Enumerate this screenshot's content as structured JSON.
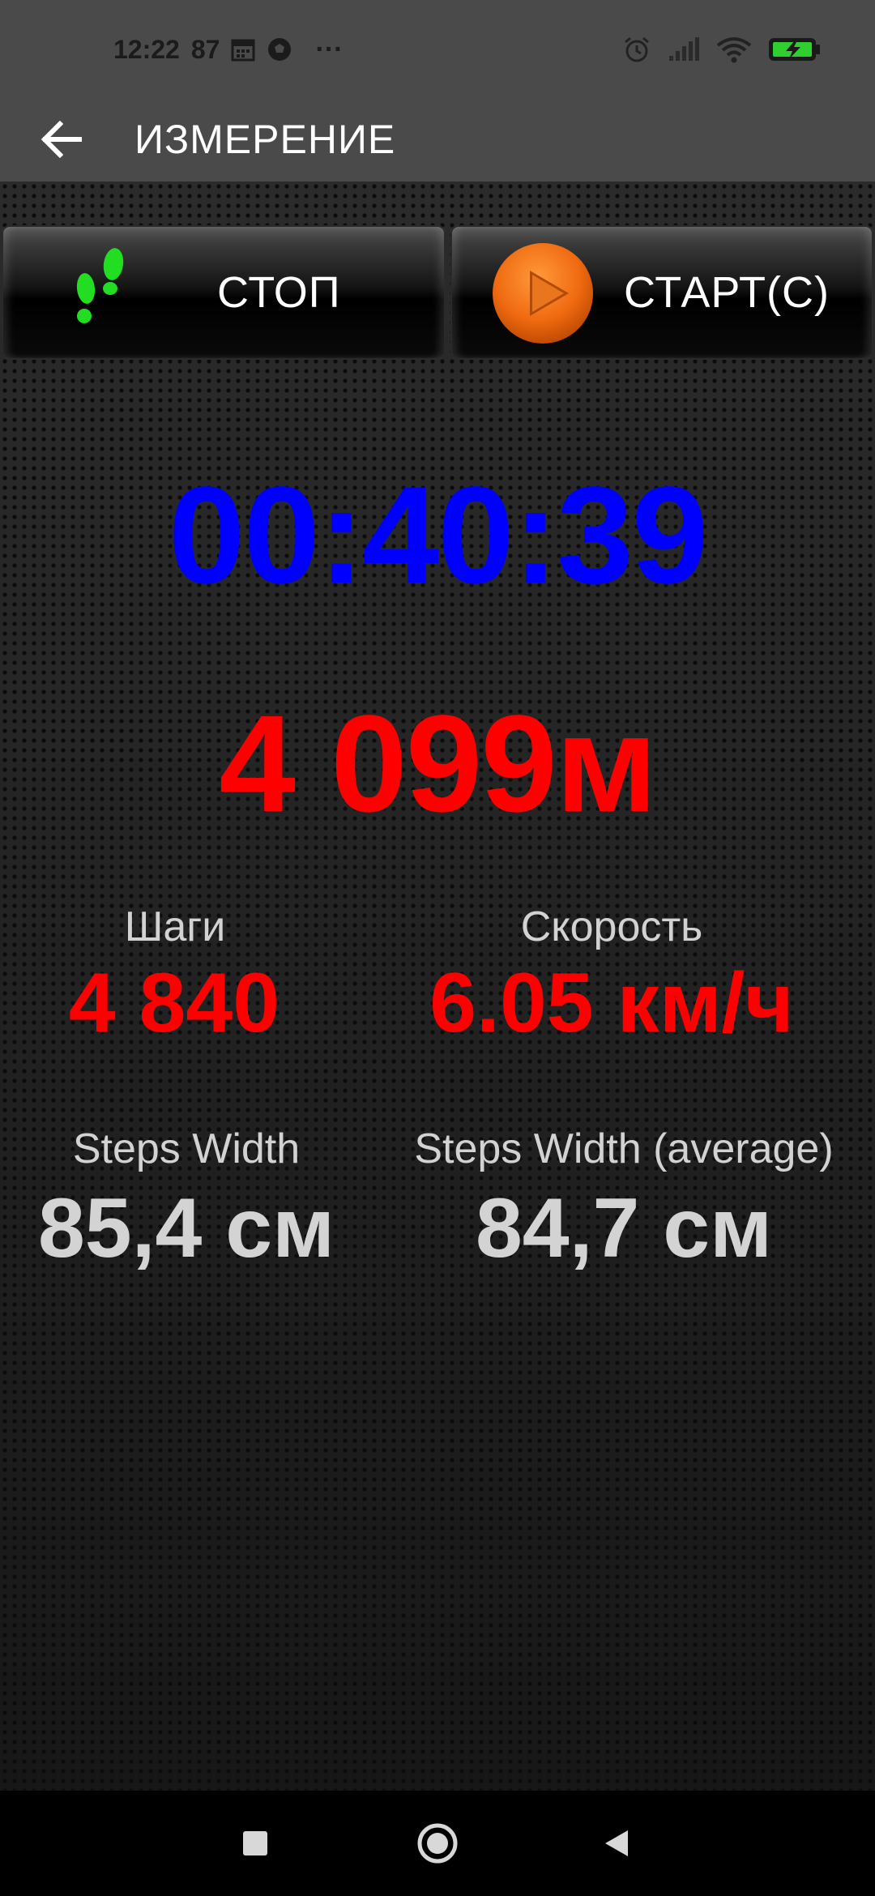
{
  "status_bar": {
    "time": "12:22",
    "notification_count": "87",
    "icons": [
      "calendar-icon",
      "soccer-ball-icon",
      "more-dots-icon",
      "alarm-icon",
      "signal-icon",
      "wifi-icon",
      "battery-charging-icon"
    ],
    "more": "···"
  },
  "app_bar": {
    "title": "ИЗМЕРЕНИЕ",
    "back_icon": "arrow-left-icon"
  },
  "buttons": {
    "stop_label": "СТОП",
    "start_label": "СТАРТ(С)",
    "stop_icon": "footsteps-icon",
    "start_icon": "play-icon"
  },
  "readouts": {
    "timer": "00:40:39",
    "distance": "4 099м"
  },
  "stats": {
    "steps_label": "Шаги",
    "steps_value": "4 840",
    "speed_label": "Скорость",
    "speed_value": "6.05 км/ч",
    "width_label": "Steps Width",
    "width_value": "85,4 см",
    "width_avg_label": "Steps Width (average)",
    "width_avg_value": "84,7 см"
  },
  "colors": {
    "timer": "#0000ff",
    "red_values": "#ff0000",
    "feet": "#22dd22",
    "play": "#f06010"
  },
  "nav_bar": {
    "icons": [
      "square-recents-icon",
      "circle-home-icon",
      "triangle-back-icon"
    ]
  }
}
